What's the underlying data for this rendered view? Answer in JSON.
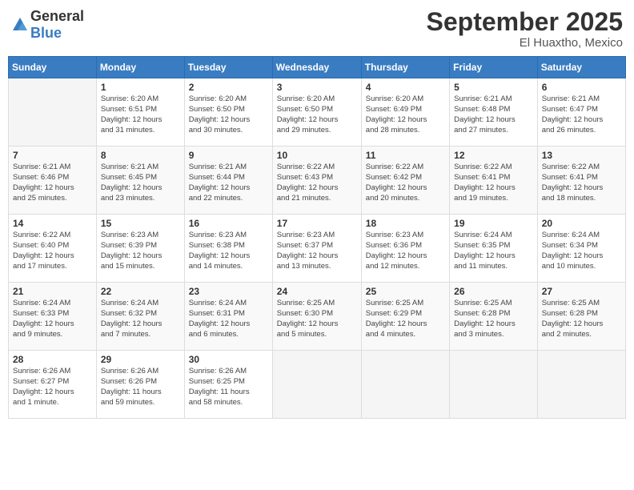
{
  "header": {
    "logo_general": "General",
    "logo_blue": "Blue",
    "month": "September 2025",
    "location": "El Huaxtho, Mexico"
  },
  "days_of_week": [
    "Sunday",
    "Monday",
    "Tuesday",
    "Wednesday",
    "Thursday",
    "Friday",
    "Saturday"
  ],
  "weeks": [
    [
      {
        "day": "",
        "info": ""
      },
      {
        "day": "1",
        "info": "Sunrise: 6:20 AM\nSunset: 6:51 PM\nDaylight: 12 hours\nand 31 minutes."
      },
      {
        "day": "2",
        "info": "Sunrise: 6:20 AM\nSunset: 6:50 PM\nDaylight: 12 hours\nand 30 minutes."
      },
      {
        "day": "3",
        "info": "Sunrise: 6:20 AM\nSunset: 6:50 PM\nDaylight: 12 hours\nand 29 minutes."
      },
      {
        "day": "4",
        "info": "Sunrise: 6:20 AM\nSunset: 6:49 PM\nDaylight: 12 hours\nand 28 minutes."
      },
      {
        "day": "5",
        "info": "Sunrise: 6:21 AM\nSunset: 6:48 PM\nDaylight: 12 hours\nand 27 minutes."
      },
      {
        "day": "6",
        "info": "Sunrise: 6:21 AM\nSunset: 6:47 PM\nDaylight: 12 hours\nand 26 minutes."
      }
    ],
    [
      {
        "day": "7",
        "info": "Sunrise: 6:21 AM\nSunset: 6:46 PM\nDaylight: 12 hours\nand 25 minutes."
      },
      {
        "day": "8",
        "info": "Sunrise: 6:21 AM\nSunset: 6:45 PM\nDaylight: 12 hours\nand 23 minutes."
      },
      {
        "day": "9",
        "info": "Sunrise: 6:21 AM\nSunset: 6:44 PM\nDaylight: 12 hours\nand 22 minutes."
      },
      {
        "day": "10",
        "info": "Sunrise: 6:22 AM\nSunset: 6:43 PM\nDaylight: 12 hours\nand 21 minutes."
      },
      {
        "day": "11",
        "info": "Sunrise: 6:22 AM\nSunset: 6:42 PM\nDaylight: 12 hours\nand 20 minutes."
      },
      {
        "day": "12",
        "info": "Sunrise: 6:22 AM\nSunset: 6:41 PM\nDaylight: 12 hours\nand 19 minutes."
      },
      {
        "day": "13",
        "info": "Sunrise: 6:22 AM\nSunset: 6:41 PM\nDaylight: 12 hours\nand 18 minutes."
      }
    ],
    [
      {
        "day": "14",
        "info": "Sunrise: 6:22 AM\nSunset: 6:40 PM\nDaylight: 12 hours\nand 17 minutes."
      },
      {
        "day": "15",
        "info": "Sunrise: 6:23 AM\nSunset: 6:39 PM\nDaylight: 12 hours\nand 15 minutes."
      },
      {
        "day": "16",
        "info": "Sunrise: 6:23 AM\nSunset: 6:38 PM\nDaylight: 12 hours\nand 14 minutes."
      },
      {
        "day": "17",
        "info": "Sunrise: 6:23 AM\nSunset: 6:37 PM\nDaylight: 12 hours\nand 13 minutes."
      },
      {
        "day": "18",
        "info": "Sunrise: 6:23 AM\nSunset: 6:36 PM\nDaylight: 12 hours\nand 12 minutes."
      },
      {
        "day": "19",
        "info": "Sunrise: 6:24 AM\nSunset: 6:35 PM\nDaylight: 12 hours\nand 11 minutes."
      },
      {
        "day": "20",
        "info": "Sunrise: 6:24 AM\nSunset: 6:34 PM\nDaylight: 12 hours\nand 10 minutes."
      }
    ],
    [
      {
        "day": "21",
        "info": "Sunrise: 6:24 AM\nSunset: 6:33 PM\nDaylight: 12 hours\nand 9 minutes."
      },
      {
        "day": "22",
        "info": "Sunrise: 6:24 AM\nSunset: 6:32 PM\nDaylight: 12 hours\nand 7 minutes."
      },
      {
        "day": "23",
        "info": "Sunrise: 6:24 AM\nSunset: 6:31 PM\nDaylight: 12 hours\nand 6 minutes."
      },
      {
        "day": "24",
        "info": "Sunrise: 6:25 AM\nSunset: 6:30 PM\nDaylight: 12 hours\nand 5 minutes."
      },
      {
        "day": "25",
        "info": "Sunrise: 6:25 AM\nSunset: 6:29 PM\nDaylight: 12 hours\nand 4 minutes."
      },
      {
        "day": "26",
        "info": "Sunrise: 6:25 AM\nSunset: 6:28 PM\nDaylight: 12 hours\nand 3 minutes."
      },
      {
        "day": "27",
        "info": "Sunrise: 6:25 AM\nSunset: 6:28 PM\nDaylight: 12 hours\nand 2 minutes."
      }
    ],
    [
      {
        "day": "28",
        "info": "Sunrise: 6:26 AM\nSunset: 6:27 PM\nDaylight: 12 hours\nand 1 minute."
      },
      {
        "day": "29",
        "info": "Sunrise: 6:26 AM\nSunset: 6:26 PM\nDaylight: 11 hours\nand 59 minutes."
      },
      {
        "day": "30",
        "info": "Sunrise: 6:26 AM\nSunset: 6:25 PM\nDaylight: 11 hours\nand 58 minutes."
      },
      {
        "day": "",
        "info": ""
      },
      {
        "day": "",
        "info": ""
      },
      {
        "day": "",
        "info": ""
      },
      {
        "day": "",
        "info": ""
      }
    ]
  ]
}
